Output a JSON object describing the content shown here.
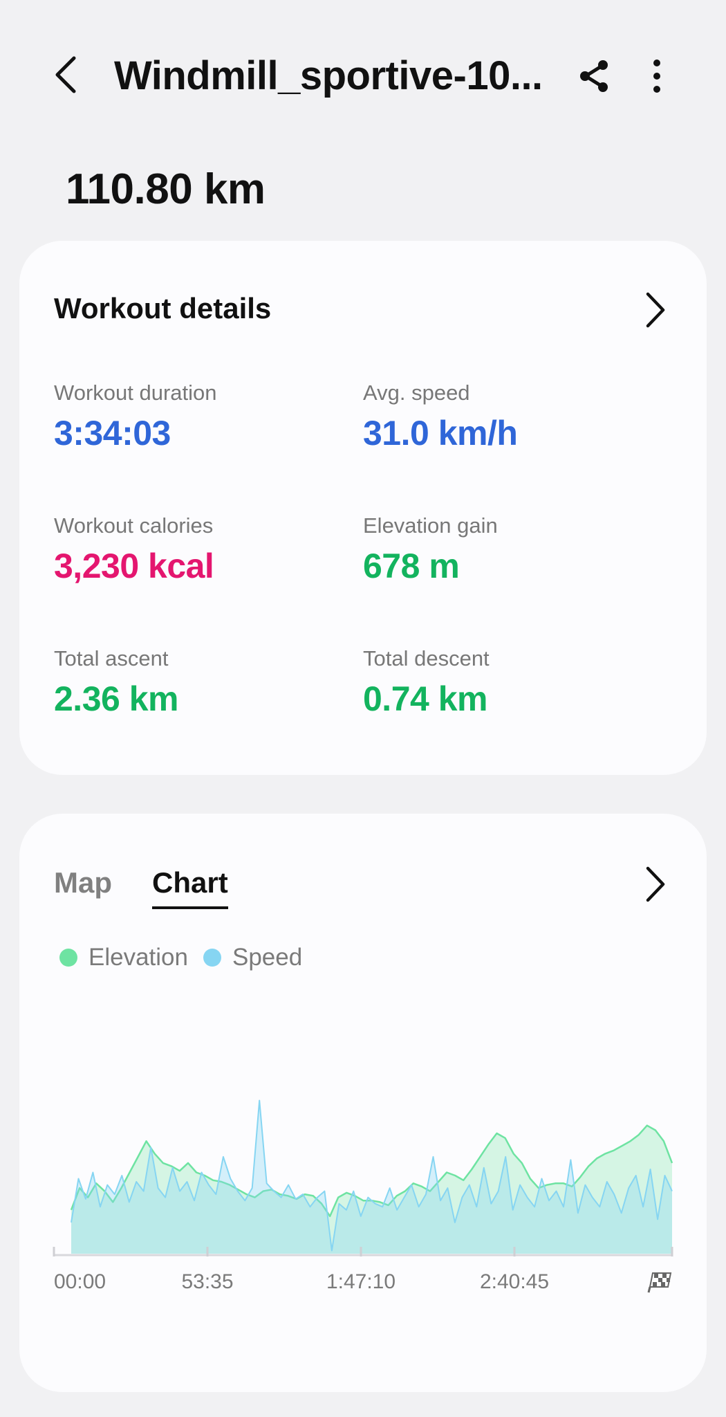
{
  "header": {
    "title": "Windmill_sportive-10...",
    "back_icon": "chevron-left-icon",
    "share_icon": "share-icon",
    "more_icon": "more-vertical-icon"
  },
  "summary": {
    "distance": "110.80 km"
  },
  "workout_details": {
    "title": "Workout details",
    "stats": [
      {
        "label": "Workout duration",
        "value": "3:34:03",
        "color": "#2f66d8"
      },
      {
        "label": "Avg. speed",
        "value": "31.0 km/h",
        "color": "#2f66d8"
      },
      {
        "label": "Workout calories",
        "value": "3,230 kcal",
        "color": "#e4166f"
      },
      {
        "label": "Elevation gain",
        "value": "678 m",
        "color": "#13b35e"
      },
      {
        "label": "Total ascent",
        "value": "2.36 km",
        "color": "#13b35e"
      },
      {
        "label": "Total descent",
        "value": "0.74 km",
        "color": "#13b35e"
      }
    ]
  },
  "chart_card": {
    "tabs": [
      {
        "label": "Map",
        "selected": false
      },
      {
        "label": "Chart",
        "selected": true
      }
    ],
    "legend": [
      {
        "label": "Elevation",
        "color": "#6ee3a2"
      },
      {
        "label": "Speed",
        "color": "#86d5f2"
      }
    ],
    "finish_icon": "checkered-flag-icon"
  },
  "chart_data": {
    "type": "area",
    "xlabel": "",
    "ylabel": "",
    "x_ticks": [
      "00:00",
      "53:35",
      "1:47:10",
      "2:40:45"
    ],
    "x_range_seconds": [
      0,
      12843
    ],
    "grid": false,
    "legend": "top-left",
    "series": [
      {
        "name": "Elevation",
        "color": "#6ee3a2",
        "relative_values": [
          0.28,
          0.42,
          0.36,
          0.45,
          0.4,
          0.33,
          0.42,
          0.52,
          0.62,
          0.72,
          0.64,
          0.58,
          0.56,
          0.53,
          0.58,
          0.52,
          0.5,
          0.47,
          0.46,
          0.44,
          0.41,
          0.38,
          0.36,
          0.4,
          0.41,
          0.38,
          0.37,
          0.35,
          0.38,
          0.37,
          0.32,
          0.24,
          0.36,
          0.39,
          0.37,
          0.34,
          0.34,
          0.33,
          0.31,
          0.37,
          0.4,
          0.45,
          0.43,
          0.4,
          0.46,
          0.52,
          0.5,
          0.47,
          0.54,
          0.62,
          0.7,
          0.77,
          0.74,
          0.64,
          0.58,
          0.48,
          0.42,
          0.44,
          0.45,
          0.45,
          0.43,
          0.49,
          0.56,
          0.61,
          0.64,
          0.66,
          0.69,
          0.72,
          0.76,
          0.82,
          0.79,
          0.72,
          0.58
        ]
      },
      {
        "name": "Speed",
        "color": "#86d5f2",
        "relative_values": [
          0.2,
          0.48,
          0.35,
          0.52,
          0.3,
          0.44,
          0.38,
          0.5,
          0.33,
          0.46,
          0.4,
          0.68,
          0.42,
          0.36,
          0.55,
          0.4,
          0.46,
          0.34,
          0.52,
          0.44,
          0.38,
          0.62,
          0.48,
          0.4,
          0.34,
          0.42,
          0.98,
          0.45,
          0.4,
          0.36,
          0.44,
          0.35,
          0.38,
          0.3,
          0.36,
          0.4,
          0.02,
          0.32,
          0.28,
          0.4,
          0.24,
          0.36,
          0.32,
          0.3,
          0.42,
          0.28,
          0.36,
          0.44,
          0.3,
          0.38,
          0.62,
          0.34,
          0.42,
          0.2,
          0.36,
          0.44,
          0.3,
          0.55,
          0.32,
          0.4,
          0.62,
          0.28,
          0.44,
          0.36,
          0.3,
          0.48,
          0.34,
          0.4,
          0.3,
          0.6,
          0.26,
          0.44,
          0.36,
          0.3,
          0.46,
          0.38,
          0.26,
          0.42,
          0.5,
          0.3,
          0.54,
          0.22,
          0.5,
          0.4
        ]
      }
    ]
  }
}
